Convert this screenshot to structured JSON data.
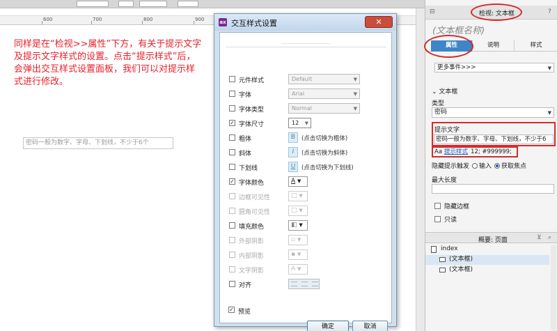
{
  "ruler": {
    "ticks": [
      "600",
      "700",
      "800",
      "900"
    ]
  },
  "canvas": {
    "description": "同样是在“检视>>属性”下方，有关于提示文字及提示文字样式的设置。点击“提示样式”后，会弹出交互样式设置面板，我们可以对提示样式进行修改。",
    "hint_input_text": "密码一般为数字、字母、下划线，不少于6个"
  },
  "dialog": {
    "title": "交互样式设置",
    "logo": "ax",
    "close": "✕",
    "rows": [
      {
        "label": "元件样式",
        "checked": false,
        "disabled": false,
        "kind": "select",
        "value": "Default"
      },
      {
        "label": "字体",
        "checked": false,
        "disabled": false,
        "kind": "select",
        "value": "Arial"
      },
      {
        "label": "字体类型",
        "checked": false,
        "disabled": false,
        "kind": "select",
        "value": "Normal"
      },
      {
        "label": "字体尺寸",
        "checked": true,
        "disabled": false,
        "kind": "select-small",
        "value": "12"
      },
      {
        "label": "粗体",
        "checked": false,
        "disabled": false,
        "kind": "format",
        "glyph": "B",
        "hint": "(点击切换为粗体)"
      },
      {
        "label": "斜体",
        "checked": false,
        "disabled": false,
        "kind": "format",
        "glyph": "I",
        "hint": "(点击切换为斜体)"
      },
      {
        "label": "下划线",
        "checked": false,
        "disabled": false,
        "kind": "format",
        "glyph": "U",
        "hint": "(点击切换为下划线)"
      },
      {
        "label": "字体颜色",
        "checked": true,
        "disabled": false,
        "kind": "color",
        "glyph": "A"
      },
      {
        "label": "边框可见性",
        "checked": false,
        "disabled": true,
        "kind": "color-dim"
      },
      {
        "label": "圆角可见性",
        "checked": false,
        "disabled": true,
        "kind": "color-dim"
      },
      {
        "label": "填充颜色",
        "checked": false,
        "disabled": false,
        "kind": "color",
        "glyph": ""
      },
      {
        "label": "外部阴影",
        "checked": false,
        "disabled": true,
        "kind": "color-dim"
      },
      {
        "label": "内部阴影",
        "checked": false,
        "disabled": true,
        "kind": "color-dim"
      },
      {
        "label": "文字阴影",
        "checked": false,
        "disabled": true,
        "kind": "color-dim",
        "glyph": "A"
      },
      {
        "label": "对齐",
        "checked": false,
        "disabled": false,
        "kind": "align"
      }
    ],
    "preview_label": "预览",
    "preview_checked": true,
    "ok_label": "确定",
    "cancel_label": "取消"
  },
  "inspector": {
    "header_title": "检视: 文本框",
    "widget_name": "(文本框名称)",
    "tabs": [
      {
        "label": "属性",
        "active": true
      },
      {
        "label": "说明",
        "active": false
      },
      {
        "label": "样式",
        "active": false
      }
    ],
    "more_events": "更多事件>>>",
    "section_textbox": "文本框",
    "type_label": "类型",
    "type_value": "密码",
    "hint_label": "提示文字",
    "hint_value": "密码一般为数字、字母、下划线，不少于6",
    "hint_style_prefix": "Aa",
    "hint_style_link": "提示样式",
    "hint_style_value": "12; #999999;",
    "hide_hint_label": "隐藏提示触发",
    "hide_hint_opt1": "输入",
    "hide_hint_opt2": "获取焦点",
    "maxlen_label": "最大长度",
    "hide_border_label": "隐藏边框",
    "readonly_label": "只读",
    "outline_title": "概要: 页面",
    "outline_items": [
      "index",
      "(文本框)",
      "(文本框)"
    ]
  },
  "colors": {
    "annotation_red": "#d42a2a",
    "tab_active": "#3e86c8",
    "description_text": "#e8202a"
  }
}
